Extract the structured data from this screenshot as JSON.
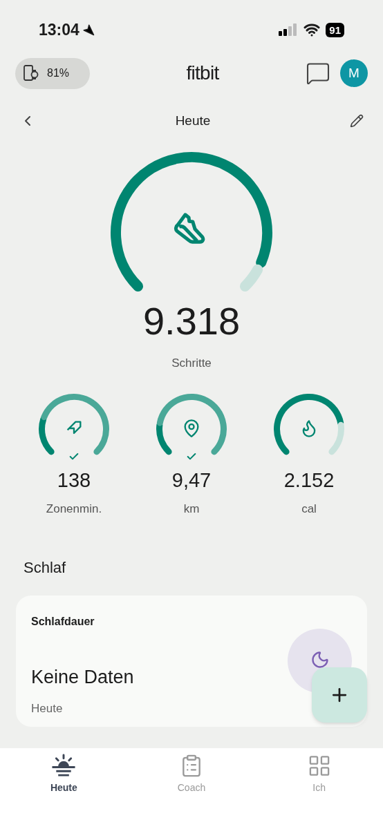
{
  "status_bar": {
    "time": "13:04",
    "battery": "91"
  },
  "header": {
    "device_battery": "81%",
    "logo": "fitbit",
    "avatar": "M"
  },
  "date_nav": {
    "title": "Heute"
  },
  "steps": {
    "value": "9.318",
    "label": "Schritte"
  },
  "metrics": [
    {
      "value": "138",
      "label": "Zonenmin.",
      "goal_met": true,
      "kind": "zone"
    },
    {
      "value": "9,47",
      "label": "km",
      "goal_met": true,
      "kind": "distance"
    },
    {
      "value": "2.152",
      "label": "cal",
      "goal_met": false,
      "kind": "calories"
    }
  ],
  "section": {
    "title": "Schlaf"
  },
  "sleep_card": {
    "title": "Schlafdauer",
    "value": "Keine Daten",
    "subtitle": "Heute"
  },
  "nav": [
    {
      "label": "Heute",
      "selected": true,
      "kind": "today"
    },
    {
      "label": "Coach",
      "selected": false,
      "kind": "coach"
    },
    {
      "label": "Ich",
      "selected": false,
      "kind": "me"
    }
  ]
}
